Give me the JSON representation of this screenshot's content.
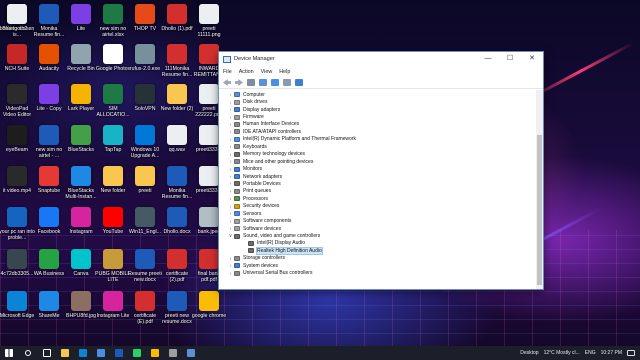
{
  "desktop_icons": [
    {
      "label": "blinking screen is...",
      "icon": "video-icon",
      "color": "#3a3a3a"
    },
    {
      "label": "NCH Suite",
      "icon": "nch-suite-icon",
      "color": "#c62828"
    },
    {
      "label": "VideoPad Video Editor",
      "icon": "videopad-icon",
      "color": "#2b2b2b"
    },
    {
      "label": "eyeBeam",
      "icon": "eyebeam-icon",
      "color": "#1d1d1d"
    },
    {
      "label": "it video.mp4",
      "icon": "video-file-icon",
      "color": "#2a2a2a"
    },
    {
      "label": "your pc ran into proble...",
      "icon": "image-file-icon",
      "color": "#1565c0"
    },
    {
      "label": "4c72db3305...",
      "icon": "image-file-icon",
      "color": "#37474f"
    },
    {
      "label": "Microsoft Edge",
      "icon": "edge-icon",
      "color": "#0a84d6"
    },
    {
      "label": "Monika Resume fin...",
      "icon": "word-icon",
      "color": "#1e5bb8"
    },
    {
      "label": "Audacity",
      "icon": "audacity-icon",
      "color": "#e65100"
    },
    {
      "label": "Lite - Copy",
      "icon": "messenger-icon",
      "color": "#7b3fe4"
    },
    {
      "label": "new sim no airtel - ...",
      "icon": "word-icon",
      "color": "#1e5bb8"
    },
    {
      "label": "Snaptube",
      "icon": "snaptube-icon",
      "color": "#e53935"
    },
    {
      "label": "Facebook",
      "icon": "facebook-icon",
      "color": "#1877f2"
    },
    {
      "label": "WA Business",
      "icon": "whatsapp-business-icon",
      "color": "#25a244"
    },
    {
      "label": "ShareMe",
      "icon": "shareme-icon",
      "color": "#1e88e5"
    },
    {
      "label": "Lite",
      "icon": "messenger-icon",
      "color": "#7b3fe4"
    },
    {
      "label": "Recycle Bin",
      "icon": "recycle-bin-icon",
      "color": "#90a4ae"
    },
    {
      "label": "Lark Player",
      "icon": "lark-player-icon",
      "color": "#f4b400"
    },
    {
      "label": "BlueStacks",
      "icon": "bluestacks-icon",
      "color": "#43a047"
    },
    {
      "label": "BlueStacks Multi-Instan...",
      "icon": "bluestacks-icon",
      "color": "#1e88e5"
    },
    {
      "label": "Instagram",
      "icon": "instagram-icon",
      "color": "#d6249f"
    },
    {
      "label": "Canva",
      "icon": "canva-icon",
      "color": "#00c4cc"
    },
    {
      "label": "BHPU8fd.jpg",
      "icon": "image-file-icon",
      "color": "#8d6e63"
    },
    {
      "label": "new sim no airtel.xlsx",
      "icon": "excel-icon",
      "color": "#1d7a45"
    },
    {
      "label": "Google Photos",
      "icon": "google-photos-icon",
      "color": "#ffffff"
    },
    {
      "label": "SIM ALLOCATIO...",
      "icon": "excel-icon",
      "color": "#1d7a45"
    },
    {
      "label": "TapTap",
      "icon": "taptap-icon",
      "color": "#18b4c6"
    },
    {
      "label": "New folder",
      "icon": "folder-icon",
      "color": "#f9c74f"
    },
    {
      "label": "YouTube",
      "icon": "youtube-icon",
      "color": "#ff0000"
    },
    {
      "label": "PUBG MOBILE LITE",
      "icon": "pubg-icon",
      "color": "#c79a3b"
    },
    {
      "label": "Instagram Lite",
      "icon": "instagram-icon",
      "color": "#d6249f"
    },
    {
      "label": "THOP TV",
      "icon": "thop-tv-icon",
      "color": "#e64a19"
    },
    {
      "label": "rufus-2.0.exe",
      "icon": "usb-drive-icon",
      "color": "#78909c"
    },
    {
      "label": "SoloVPN",
      "icon": "vpn-icon",
      "color": "#263238"
    },
    {
      "label": "Windows 10 Upgrade A...",
      "icon": "windows-icon",
      "color": "#0078d7"
    },
    {
      "label": "preeti",
      "icon": "folder-icon",
      "color": "#f9c74f"
    },
    {
      "label": "Win11_Engl...",
      "icon": "disc-image-icon",
      "color": "#455a64"
    },
    {
      "label": "Resume preeti new.docx",
      "icon": "word-icon",
      "color": "#1e5bb8"
    },
    {
      "label": "certificate (E).pdf",
      "icon": "pdf-icon",
      "color": "#d32f2f"
    },
    {
      "label": "Dhollo (1).pdf",
      "icon": "pdf-icon",
      "color": "#d32f2f"
    },
    {
      "label": "111Monika Resume fin...",
      "icon": "pdf-icon",
      "color": "#d32f2f"
    },
    {
      "label": "New folder (2)",
      "icon": "folder-icon",
      "color": "#f9c74f"
    },
    {
      "label": "qq.wav",
      "icon": "audio-file-icon",
      "color": "#eceff1"
    },
    {
      "label": "Monika Resume fin...",
      "icon": "word-icon",
      "color": "#1e5bb8"
    },
    {
      "label": "Dhollo.docx",
      "icon": "word-icon",
      "color": "#1e5bb8"
    },
    {
      "label": "certificate (2).pdf",
      "icon": "pdf-icon",
      "color": "#d32f2f"
    },
    {
      "label": "preeti new resume.docx",
      "icon": "word-icon",
      "color": "#1e5bb8"
    },
    {
      "label": "preeti 11111.png",
      "icon": "image-file-icon",
      "color": "#eceff1"
    },
    {
      "label": "INWARD REMITTAN...",
      "icon": "pdf-icon",
      "color": "#d32f2f"
    },
    {
      "label": "preeti 222222.png",
      "icon": "image-file-icon",
      "color": "#eceff1"
    },
    {
      "label": "preeti333...",
      "icon": "image-file-icon",
      "color": "#eceff1"
    },
    {
      "label": "preeti333...",
      "icon": "image-file-icon",
      "color": "#eceff1"
    },
    {
      "label": "bank.jpeg",
      "icon": "image-file-icon",
      "color": "#b0bec5"
    },
    {
      "label": "final bank pdf.pdf",
      "icon": "pdf-icon",
      "color": "#d32f2f"
    },
    {
      "label": "google chrome",
      "icon": "chrome-icon",
      "color": "#fbbc05"
    },
    {
      "label": "Bluetooth2...",
      "icon": "image-file-icon",
      "color": "#eceff1"
    }
  ],
  "window": {
    "title": "Device Manager",
    "minimize": "—",
    "maximize": "☐",
    "close": "✕",
    "menu": [
      "File",
      "Action",
      "View",
      "Help"
    ],
    "tree": [
      {
        "label": "Computer",
        "icon": "computer-icon",
        "color": "#5b8fd6",
        "expanded": false,
        "level": 0
      },
      {
        "label": "Disk drives",
        "icon": "disk-drive-icon",
        "color": "#9e9e9e",
        "expanded": false,
        "level": 0
      },
      {
        "label": "Display adapters",
        "icon": "display-adapter-icon",
        "color": "#3f7fd0",
        "expanded": false,
        "level": 0
      },
      {
        "label": "Firmware",
        "icon": "firmware-icon",
        "color": "#9e9e9e",
        "expanded": false,
        "level": 0
      },
      {
        "label": "Human Interface Devices",
        "icon": "hid-icon",
        "color": "#8a8a8a",
        "expanded": false,
        "level": 0
      },
      {
        "label": "IDE ATA/ATAPI controllers",
        "icon": "ide-controller-icon",
        "color": "#8a8a8a",
        "expanded": false,
        "level": 0
      },
      {
        "label": "Intel(R) Dynamic Platform and Thermal Framework",
        "icon": "thermal-icon",
        "color": "#4a8fdc",
        "expanded": false,
        "level": 0
      },
      {
        "label": "Keyboards",
        "icon": "keyboard-icon",
        "color": "#8a8a8a",
        "expanded": false,
        "level": 0
      },
      {
        "label": "Memory technology devices",
        "icon": "memory-icon",
        "color": "#6b6b6b",
        "expanded": false,
        "level": 0
      },
      {
        "label": "Mice and other pointing devices",
        "icon": "mouse-icon",
        "color": "#8a8a8a",
        "expanded": false,
        "level": 0
      },
      {
        "label": "Monitors",
        "icon": "monitor-icon",
        "color": "#3f7fd0",
        "expanded": false,
        "level": 0
      },
      {
        "label": "Network adapters",
        "icon": "network-adapter-icon",
        "color": "#3f7fd0",
        "expanded": false,
        "level": 0
      },
      {
        "label": "Portable Devices",
        "icon": "portable-device-icon",
        "color": "#6b6b6b",
        "expanded": false,
        "level": 0
      },
      {
        "label": "Print queues",
        "icon": "printer-icon",
        "color": "#8a8a8a",
        "expanded": false,
        "level": 0
      },
      {
        "label": "Processors",
        "icon": "processor-icon",
        "color": "#5a8f5a",
        "expanded": false,
        "level": 0
      },
      {
        "label": "Security devices",
        "icon": "security-device-icon",
        "color": "#d4a017",
        "expanded": false,
        "level": 0
      },
      {
        "label": "Sensors",
        "icon": "sensor-icon",
        "color": "#4a8fdc",
        "expanded": false,
        "level": 0
      },
      {
        "label": "Software components",
        "icon": "software-component-icon",
        "color": "#9e9e9e",
        "expanded": false,
        "level": 0
      },
      {
        "label": "Software devices",
        "icon": "software-device-icon",
        "color": "#9e9e9e",
        "expanded": false,
        "level": 0
      },
      {
        "label": "Sound, video and game controllers",
        "icon": "speaker-icon",
        "color": "#6b6b6b",
        "expanded": true,
        "level": 0
      },
      {
        "label": "Intel(R) Display Audio",
        "icon": "speaker-icon",
        "color": "#6b6b6b",
        "expanded": null,
        "level": 1
      },
      {
        "label": "Realtek High Definition Audio",
        "icon": "speaker-icon",
        "color": "#6b6b6b",
        "expanded": null,
        "level": 1,
        "selected": true
      },
      {
        "label": "Storage controllers",
        "icon": "storage-controller-icon",
        "color": "#8a8a8a",
        "expanded": false,
        "level": 0
      },
      {
        "label": "System devices",
        "icon": "system-device-icon",
        "color": "#3f7fd0",
        "expanded": false,
        "level": 0
      },
      {
        "label": "Universal Serial Bus controllers",
        "icon": "usb-controller-icon",
        "color": "#8a8a8a",
        "expanded": false,
        "level": 0
      }
    ]
  },
  "taskbar": {
    "apps": [
      {
        "name": "start-button",
        "icon": "windows-icon",
        "color": "#ffffff"
      },
      {
        "name": "search-button",
        "icon": "search-icon",
        "color": "#ffffff"
      },
      {
        "name": "task-view-button",
        "icon": "task-view-icon",
        "color": "#ffffff"
      },
      {
        "name": "file-explorer-button",
        "icon": "folder-icon",
        "color": "#f9c74f"
      },
      {
        "name": "edge-button",
        "icon": "edge-icon",
        "color": "#0a84d6"
      },
      {
        "name": "store-button",
        "icon": "store-icon",
        "color": "#4a90e2"
      },
      {
        "name": "word-button",
        "icon": "word-icon",
        "color": "#1e5bb8"
      },
      {
        "name": "whatsapp-button",
        "icon": "whatsapp-icon",
        "color": "#25d366"
      },
      {
        "name": "chrome-button",
        "icon": "chrome-icon",
        "color": "#fbbc05"
      },
      {
        "name": "camera-button",
        "icon": "camera-icon",
        "color": "#9e9e9e"
      },
      {
        "name": "device-manager-button",
        "icon": "device-manager-icon",
        "color": "#5b8fd6"
      }
    ],
    "desktop_label": "Desktop",
    "weather": "12°C  Mostly cl...",
    "lang": "ENG",
    "time": "10:27 PM"
  }
}
